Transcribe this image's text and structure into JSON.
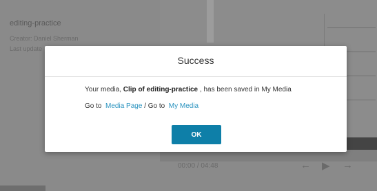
{
  "background": {
    "entry_title": "editing-practice",
    "creator_label": "Creator: Daniel Sherman",
    "updated_label": "Last update",
    "time_current": "00:00",
    "time_separator": "/",
    "time_total": "04:48",
    "icons": [
      "arrow-left-icon",
      "play-icon",
      "arrow-right-icon"
    ]
  },
  "dialog": {
    "title": "Success",
    "message_prefix": "Your media,",
    "media_name": "Clip of editing-practice",
    "message_suffix": ", has been saved in My Media",
    "goto_prefix": "Go to",
    "media_page_link": "Media Page",
    "goto_separator": "/ Go to",
    "my_media_link": "My Media",
    "ok_label": "OK"
  },
  "colors": {
    "accent": "#0e7fa8",
    "link": "#2a93bf",
    "overlay": "#8a8a8a"
  }
}
